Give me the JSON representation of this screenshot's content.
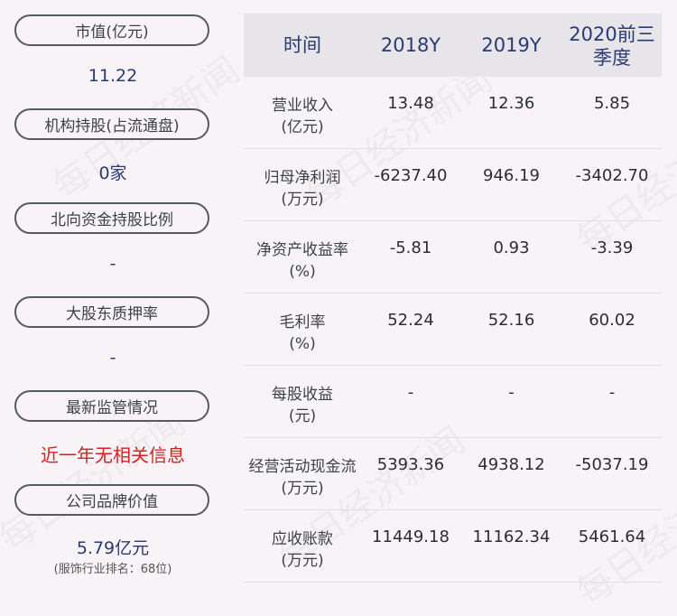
{
  "left_panel": {
    "items": [
      {
        "label": "市值(亿元)",
        "value": "11.22",
        "value_color": "#2a3b73"
      },
      {
        "label": "机构持股(占流通盘)",
        "value": "0家",
        "value_color": "#2a3b73"
      },
      {
        "label": "北向资金持股比例",
        "value": "-",
        "value_color": "#2a3b73"
      },
      {
        "label": "大股东质押率",
        "value": "-",
        "value_color": "#2a3b73"
      },
      {
        "label": "最新监管情况",
        "value": "近一年无相关信息",
        "value_color": "#d5221e"
      },
      {
        "label": "公司品牌价值",
        "value": "5.79亿元",
        "value_color": "#2a3b73",
        "sub": "(服饰行业排名：68位)"
      }
    ]
  },
  "table": {
    "headers": [
      "时间",
      "2018Y",
      "2019Y",
      "2020前三季度"
    ],
    "rows": [
      {
        "label_line1": "营业收入",
        "label_line2": "(亿元)",
        "values": [
          "13.48",
          "12.36",
          "5.85"
        ]
      },
      {
        "label_line1": "归母净利润",
        "label_line2": "(万元)",
        "values": [
          "-6237.40",
          "946.19",
          "-3402.70"
        ]
      },
      {
        "label_line1": "净资产收益率",
        "label_line2": "(%)",
        "values": [
          "-5.81",
          "0.93",
          "-3.39"
        ]
      },
      {
        "label_line1": "毛利率",
        "label_line2": "(%)",
        "values": [
          "52.24",
          "52.16",
          "60.02"
        ]
      },
      {
        "label_line1": "每股收益",
        "label_line2": "(元)",
        "values": [
          "-",
          "-",
          "-"
        ]
      },
      {
        "label_line1": "经营活动现金流",
        "label_line2": "(万元)",
        "values": [
          "5393.36",
          "4938.12",
          "-5037.19"
        ]
      },
      {
        "label_line1": "应收账款",
        "label_line2": "(万元)",
        "values": [
          "11449.18",
          "11162.34",
          "5461.64"
        ]
      }
    ]
  },
  "watermark_text": "每日经济新闻"
}
